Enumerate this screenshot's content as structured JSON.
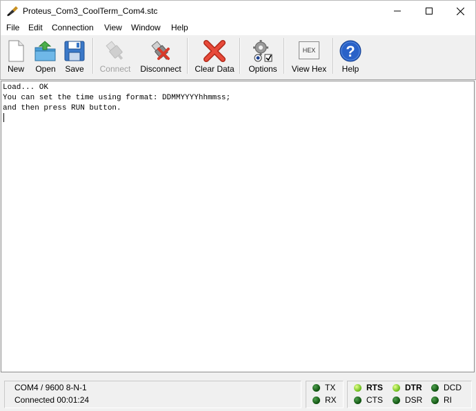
{
  "window": {
    "title": "Proteus_Com3_CoolTerm_Com4.stc"
  },
  "menu": {
    "items": [
      "File",
      "Edit",
      "Connection",
      "View",
      "Window",
      "Help"
    ]
  },
  "toolbar": {
    "new_label": "New",
    "open_label": "Open",
    "save_label": "Save",
    "connect_label": "Connect",
    "disconnect_label": "Disconnect",
    "clear_label": "Clear Data",
    "options_label": "Options",
    "viewhex_label": "View Hex",
    "hex_icon_text": "HEX",
    "help_label": "Help"
  },
  "terminal": {
    "lines": [
      "Load... OK",
      "You can set the time using format: DDMMYYYYhhmmss;",
      "and then press RUN button."
    ]
  },
  "status": {
    "port_settings": "COM4 / 9600 8-N-1",
    "connection": "Connected 00:01:24"
  },
  "signals": {
    "tx": {
      "label": "TX",
      "active": false
    },
    "rx": {
      "label": "RX",
      "active": false
    },
    "rts": {
      "label": "RTS",
      "active": true
    },
    "cts": {
      "label": "CTS",
      "active": false
    },
    "dtr": {
      "label": "DTR",
      "active": true
    },
    "dsr": {
      "label": "DSR",
      "active": false
    },
    "dcd": {
      "label": "DCD",
      "active": false
    },
    "ri": {
      "label": "RI",
      "active": false
    }
  },
  "colors": {
    "led_active": "#8ad42a",
    "led_inactive": "#1e6b1e",
    "clear_icon": "#e23a2a",
    "help_icon": "#2a62c8"
  }
}
